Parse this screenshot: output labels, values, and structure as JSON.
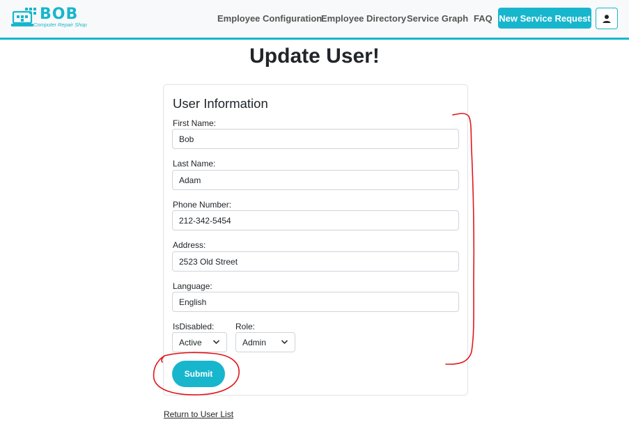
{
  "header": {
    "logo_text": "BOB",
    "logo_subtitle": "Computer Repair Shop",
    "nav": [
      {
        "label": "Employee Configuration"
      },
      {
        "label": "Employee Directory"
      },
      {
        "label": "Service Graph"
      },
      {
        "label": "FAQ"
      }
    ],
    "new_request_label": "New Service Request",
    "user_icon": "user-icon"
  },
  "page": {
    "title": "Update User!"
  },
  "form": {
    "section_title": "User Information",
    "first_name": {
      "label": "First Name:",
      "value": "Bob"
    },
    "last_name": {
      "label": "Last Name:",
      "value": "Adam"
    },
    "phone": {
      "label": "Phone Number:",
      "value": "212-342-5454"
    },
    "address": {
      "label": "Address:",
      "value": "2523 Old Street"
    },
    "language": {
      "label": "Language:",
      "value": "English"
    },
    "is_disabled": {
      "label": "IsDisabled:",
      "value": "Active"
    },
    "role": {
      "label": "Role:",
      "value": "Admin"
    },
    "submit_label": "Submit"
  },
  "footer": {
    "return_label": "Return to User List"
  },
  "colors": {
    "accent": "#17b6cd",
    "annotation": "#e0161b"
  }
}
